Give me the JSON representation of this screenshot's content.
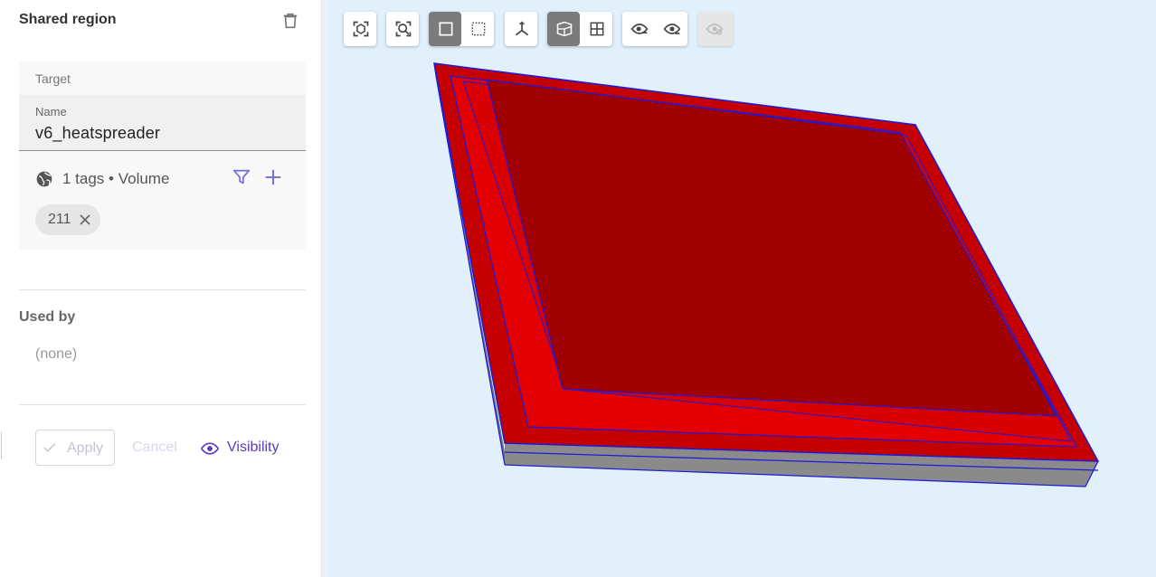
{
  "panel": {
    "title": "Shared region",
    "target": {
      "label": "Target",
      "name_label": "Name",
      "name_value": "v6_heatspreader",
      "tags_summary": "1 tags • Volume",
      "chips": [
        "211"
      ]
    },
    "used_by": {
      "title": "Used by",
      "value": "(none)"
    },
    "actions": {
      "apply": "Apply",
      "cancel": "Cancel",
      "visibility": "Visibility"
    }
  },
  "colors": {
    "accent": "#5b3bb8",
    "filter_icon": "#7b74d8",
    "model_face": "#a00000",
    "model_bevel": "#e00000",
    "model_edges": "#1a1adc",
    "model_side": "#7b7b7b",
    "viewport_bg": "#e1f0fb"
  },
  "toolbar": {
    "icons": [
      "fit-selection-icon",
      "zoom-to-fit-icon",
      "single-select-icon",
      "box-select-icon",
      "axes-icon",
      "view-cube-icon",
      "grid-icon",
      "hide-icon",
      "show-icon",
      "show-all-disabled-icon"
    ],
    "active": [
      "single-select-icon",
      "view-cube-icon"
    ]
  }
}
